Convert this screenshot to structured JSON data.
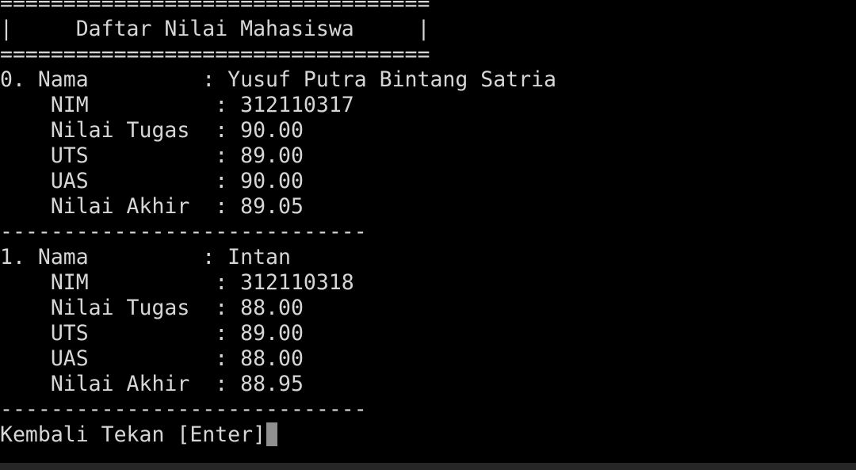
{
  "terminal": {
    "lines": [
      "==================================",
      "|     Daftar Nilai Mahasiswa     |",
      "==================================",
      "0. Nama         : Yusuf Putra Bintang Satria",
      "    NIM          : 312110317",
      "    Nilai Tugas  : 90.00",
      "    UTS          : 89.00",
      "    UAS          : 90.00",
      "    Nilai Akhir  : 89.05",
      "-----------------------------",
      "1. Nama         : Intan",
      "    NIM          : 312110318",
      "    Nilai Tugas  : 88.00",
      "    UTS          : 89.00",
      "    UAS          : 88.00",
      "    Nilai Akhir  : 88.95",
      "-----------------------------"
    ],
    "prompt": "Kembali Tekan [Enter]"
  }
}
